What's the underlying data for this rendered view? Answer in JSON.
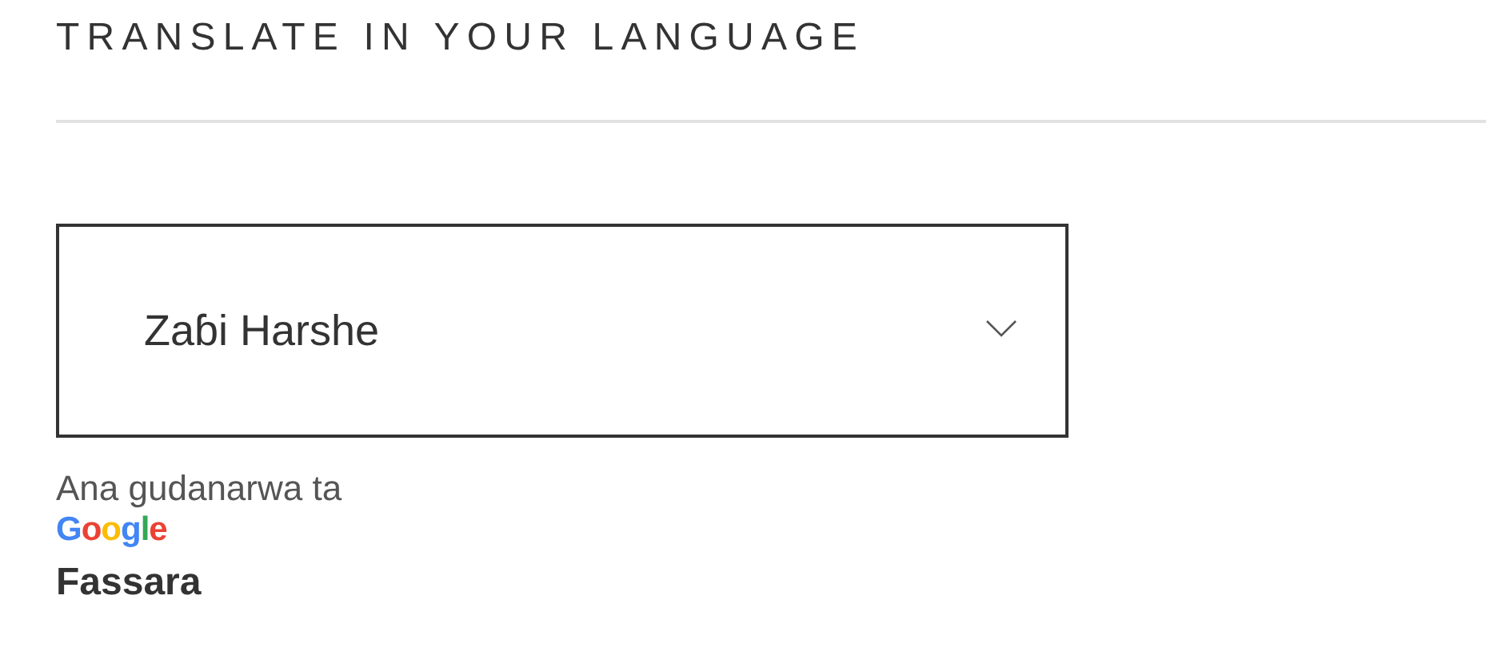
{
  "heading": "TRANSLATE IN YOUR LANGUAGE",
  "language_select": {
    "value": "Zaɓi Harshe"
  },
  "powered_by": {
    "text": "Ana gudanarwa ta",
    "logo": "Google"
  },
  "translate_label": "Fassara"
}
